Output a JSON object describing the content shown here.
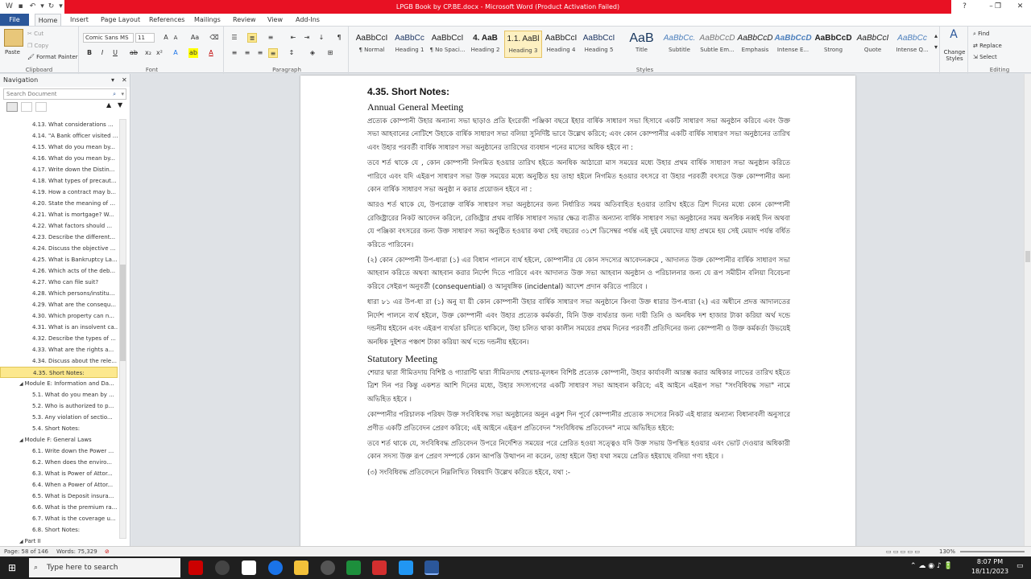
{
  "window": {
    "title": "LPGB Book by CP.BE.docx  -  Microsoft Word (Product Activation Failed)",
    "controls": [
      "?",
      "–",
      "❐",
      "✕"
    ]
  },
  "ribbon_tabs": [
    "File",
    "Home",
    "Insert",
    "Page Layout",
    "References",
    "Mailings",
    "Review",
    "View",
    "Add-Ins"
  ],
  "clipboard": {
    "paste": "Paste",
    "cut": "Cut",
    "copy": "Copy",
    "format_painter": "Format Painter",
    "label": "Clipboard"
  },
  "font": {
    "name": "Comic Sans MS",
    "size": "11",
    "label": "Font"
  },
  "paragraph": {
    "label": "Paragraph"
  },
  "styles": {
    "label": "Styles",
    "items": [
      {
        "preview": "AaBbCcI",
        "name": "¶ Normal"
      },
      {
        "preview": "AaBbCc",
        "name": "Heading 1"
      },
      {
        "preview": "AaBbCcI",
        "name": "¶ No Spaci..."
      },
      {
        "preview": "4.  AaB",
        "name": "Heading 2"
      },
      {
        "preview": "1.1.  AaBl",
        "name": "Heading 3"
      },
      {
        "preview": "AaBbCcI",
        "name": "Heading 4"
      },
      {
        "preview": "AaBbCcI",
        "name": "Heading 5"
      },
      {
        "preview": "AaB",
        "name": "Title"
      },
      {
        "preview": "AaBbCc.",
        "name": "Subtitle"
      },
      {
        "preview": "AaBbCcD",
        "name": "Subtle Em..."
      },
      {
        "preview": "AaBbCcD",
        "name": "Emphasis"
      },
      {
        "preview": "AaBbCcD",
        "name": "Intense E..."
      },
      {
        "preview": "AaBbCcD",
        "name": "Strong"
      },
      {
        "preview": "AaBbCcI",
        "name": "Quote"
      },
      {
        "preview": "AaBbCc",
        "name": "Intense Q..."
      }
    ],
    "change_styles": "Change Styles"
  },
  "editing": {
    "find": "Find",
    "replace": "Replace",
    "select": "Select",
    "label": "Editing"
  },
  "navigation": {
    "title": "Navigation",
    "search_placeholder": "Search Document",
    "items": [
      "4.13. What considerations ...",
      "4.14. \"A Bank officer visited ...",
      "4.15. What do you mean by...",
      "4.16. What do you mean by...",
      "4.17. Write down the Distin...",
      "4.18. What types of precaut...",
      "4.19. How a contract may b...",
      "4.20. State the meaning of ...",
      "4.21. What is mortgage? W...",
      "4.22. What factors should ...",
      "4.23. Describe the different...",
      "4.24. Discuss the objective ...",
      "4.25. What is Bankruptcy La...",
      "4.26. Which acts of the deb...",
      "4.27. Who can file suit?",
      "4.28. Which persons/institu...",
      "4.29. What are the consequ...",
      "4.30. Which property can n...",
      "4.31. What is an insolvent ca...",
      "4.32. Describe the types of ...",
      "4.33. What are the rights a...",
      "4.34. Discuss about the rele...",
      "4.35. Short Notes:",
      "Module E: Information and Da...",
      "5.1. What do you mean by ...",
      "5.2. Who is authorized to p...",
      "5.3. Any violation of sectio...",
      "5.4. Short Notes:",
      "Module F: General Laws",
      "6.1. Write down the Power ...",
      "6.2. When does the enviro...",
      "6.3. What is Power of Attor...",
      "6.4. When a Power of Attor...",
      "6.5. What is Deposit insura...",
      "6.6. What is the premium ra...",
      "6.7. What is the coverage u...",
      "6.8. Short Notes:",
      "Part II"
    ],
    "selected_index": 22
  },
  "document": {
    "heading": "4.35. Short Notes:",
    "sub1": "Annual General Meeting",
    "p1": "প্রত্যেক কোম্পানী উহার অন্যান্য সভা ছাড়াও প্রতি ইংরেজী পঞ্জিকা বছরে ইহার বার্ষিক সাধারণ সভা হিসাবে একটি সাধারণ সভা অনুষ্ঠান করিবে এবং উক্ত সভা আহবানের নোটিশে উহাকে বার্ষিক সাধারণ সভা বলিয়া সুনির্দিষ্ট ভাবে উল্লেখ করিবে; এবং কোন কোম্পানীর একটি বার্ষিক সাধারণ সভা অনুষ্ঠানের তারিখ এবং উহার পরবর্তী বার্ষিক সাধারণ সভা অনুষ্ঠানের তারিখের ব্যবধান পনের মাসের অধিক হইবে না :",
    "p2": "তবে শর্ত থাকে যে , কোন কোম্পানী নিগমিত হওয়ার তারিখ হইতে অনধিক আঠারো মাস সময়ের মধ্যে উহার প্রথম বার্ষিক সাধারণ সভা অনুষ্ঠান করিতে পারিবে এবং যদি এইরূপ সাধারণ সভা উক্ত সময়ের মধ্যে অনুষ্ঠিত হয় তাহা হইলে নিগমিত হওয়ার বৎসরে বা উহার পরবর্তী বৎসরে উক্ত কোম্পানীর অন্য কোন বার্ষিক সাধারণ সভা অনুষ্ঠা ন করার প্রয়োজন হইবে না :",
    "p3": "আরও শর্ত থাকে যে, উপরোক্ত বার্ষিক সাধারণ সভা অনুষ্ঠানের জন্য নির্ধারিত সময় অতিবাহিত হওয়ার তারিখ হইতে ত্রিশ দিনের মধ্যে কোন কোম্পানী রেজিষ্ট্রারের নিকট আবেদন করিলে, রেজিষ্ট্রার প্রথম বার্ষিক সাধারণ সভার ক্ষেত্র ব্যতীত অন্যান্য বার্ষিক সাধারণ সভা অনুষ্ঠানের সময় অনধিক নব্বই দিন অথবা যে পঞ্জিকা বৎসরের জন্য উক্ত সাধারণ সভা অনুষ্ঠিত হওয়ার কথা সেই বছরের ৩১শে ডিসেম্বর পর্যন্ত এই দুই মেয়াদের যাহা প্রথমে হয় সেই মেয়াদ পর্যন্ত বর্ধিত করিতে পারিবেন।",
    "p4": "(২) কোন কোম্পানী উপ-ধারা (১) এর বিধান পালনে ব্যর্থ হইলে, কোম্পানীর যে কোন সদস্যের আবেদনক্রমে , আদালত উক্ত কোম্পানীর বার্ষিক সাধারণ সভা আহবান করিতে অথবা আহবান করার নির্দেশ দিতে পারিবে এবং আদালত উক্ত সভা আহবান অনুষ্ঠান ও পরিচালনার জন্য যে রূপ সমীচীন বলিয়া বিবেচনা করিবে সেইরূপ অনুবর্তী (consequential) ও আনুষঙ্গিক (incidental) আদেশ প্রদান করিতে পারিবে ।",
    "p5": "ধারা ৮১ এর উপ-ধা রা (১) অনু যা য়ী কোন কোম্পানী উহার বার্ষিক সাধারণ সভা অনুষ্ঠানে কিংবা উক্ত ধারার উপ-ধারা (২) এর অধীনে প্রদত্ত আদালতের নির্দেশ পালনে ব্যর্থ হইলে, উক্ত কোম্পানী এবং উহার প্রত্যেক কর্মকর্তা, যিনি উক্ত ব্যর্থতার জন্য দায়ী তিনি ও অনধিক দশ হাজার টাকা করিয়া অর্থ দন্ডে দন্ডনীয় হইবেন এবং এইরূপ ব্যর্থতা চলিতে থাকিলে, উহা চলিত থাকা কালীন সময়ের প্রথম দিনের পরবর্তী প্রতিদিনের জন্য কোম্পানী ও উক্ত কর্মকর্তা উভয়েই অনধিক দুইশত পঞ্চাশ টাকা করিয়া অর্থ দন্ডে দন্ডনীয় হইবেন।",
    "sub2": "Statutory Meeting",
    "p6": "শেয়ার দ্বারা সীমিতদায় বিশিষ্ট ও গ্যারান্টি দ্বারা সীমিতদায় শেয়ার-মূলধন বিশিষ্ট প্রত্যেক কোম্পানী, উহার কার্যাবলী আরম্ভ করার অধিকার লাভের তারিখ হইতে ত্রিশ দিন পর কিন্তু একশত আশি দিনের মধ্যে, উহার সদস্যগণের একটি সাধারণ সভা আহবান করিবে; এই আইনে এইরূপ সভা \"সংবিধিবদ্ধ সভা\" নামে অভিহিত হইবে ।",
    "p7": "কোম্পানীর পরিচালক পরিষদ উক্ত সংবিধিবদ্ধ সভা অনুষ্ঠানের অনুন একুশ দিন পূর্বে কোম্পানীর প্রত্যেক সদস্যের নিকট এই ধারার অন্যান্য বিধানাবলী অনুসারে প্রণীত একটি প্রতিবেদন প্রেরণ করিবে; এই আইনে এইরূপ প্রতিবেদন \"সংবিধিবদ্ধ প্রতিবেদন\" নামে অভিহিত হইবে:",
    "p8": "তবে শর্ত থাকে যে, সংবিধিবদ্ধ প্রতিবেদন উপরে নির্দেশিত সময়ের পরে প্রেরিত হওয়া সত্ত্বেও যদি উক্ত সভায় উপস্থিত হওয়ার এবং ভোট দেওয়ার অধিকারী কোন সদস্য উক্ত রূপ প্রেরণ সম্পর্কে কোন আপত্তি উত্থাপন না করেন, তাহা হইলে উহা যথা সময়ে প্রেরিত হইয়াছে বলিয়া গণ্য হইবে ।",
    "p9": "(৩) সংবিধিবদ্ধ প্রতিবেদনে নিম্নলিখিত বিষয়াদি উল্লেখ করিতে হইবে, যথা :-"
  },
  "statusbar": {
    "page": "Page: 58 of 146",
    "words": "Words: 75,329",
    "zoom": "130%"
  },
  "taskbar": {
    "search": "Type here to search",
    "time": "8:07 PM",
    "date": "18/11/2023"
  }
}
